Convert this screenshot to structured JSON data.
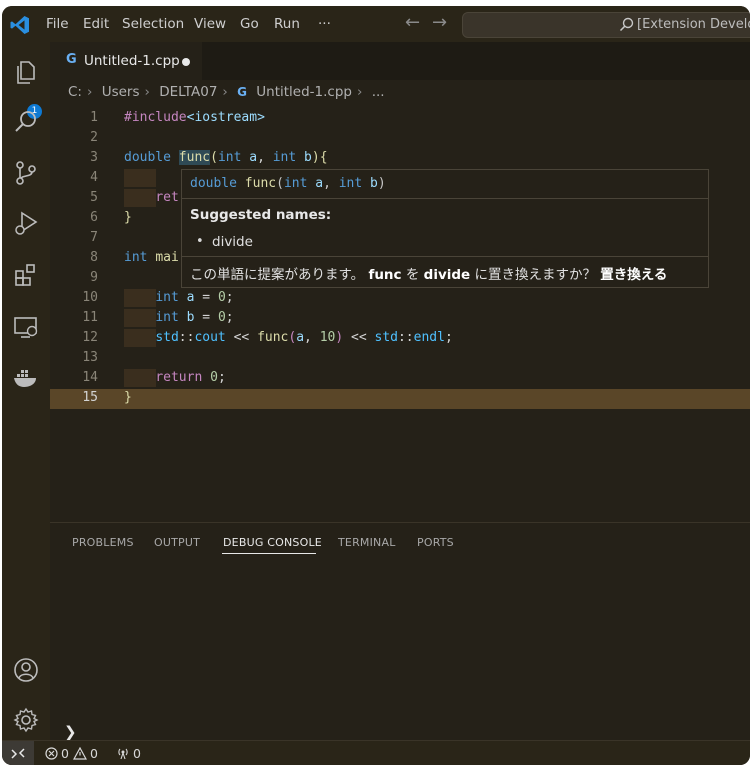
{
  "titlebar": {
    "menus": [
      "File",
      "Edit",
      "Selection",
      "View",
      "Go",
      "Run",
      "···"
    ],
    "search_text": "[Extension Developm"
  },
  "activity": {
    "explorer_badge": "1"
  },
  "tab": {
    "icon": "G",
    "label": "Untitled-1.cpp"
  },
  "breadcrumb": [
    "C:",
    "Users",
    "DELTA07",
    "Untitled-1.cpp",
    "..."
  ],
  "code": {
    "line_numbers": [
      "1",
      "2",
      "3",
      "4",
      "5",
      "6",
      "7",
      "8",
      "9",
      "10",
      "11",
      "12",
      "13",
      "14",
      "15"
    ],
    "l1_inc": "#include",
    "l1_file": "<iostream>",
    "l3_type": "double",
    "l3_fn": "func",
    "l3_p": "(",
    "l3_int1": "int",
    "l3_a": "a",
    "l3_comma": ",",
    "l3_int2": "int",
    "l3_b": "b",
    "l3_end": "){",
    "l5_ret": "ret",
    "l6": "}",
    "l8_int": "int",
    "l8_mai": "mai",
    "l10_int": "int",
    "l10_a": "a",
    "l10_eq": " = ",
    "l10_val": "0",
    "l10_semi": ";",
    "l11_int": "int",
    "l11_b": "b",
    "l11_eq": " = ",
    "l11_val": "0",
    "l11_semi": ";",
    "l12_std1": "std",
    "l12_cc1": "::",
    "l12_cout": "cout",
    "l12_op1": " << ",
    "l12_fn": "func",
    "l12_p1": "(",
    "l12_a": "a",
    "l12_comma": ", ",
    "l12_10": "10",
    "l12_p2": ")",
    "l12_op2": " << ",
    "l12_std2": "std",
    "l12_cc2": "::",
    "l12_endl": "endl",
    "l12_semi": ";",
    "l14_ret": "return",
    "l14_val": "0",
    "l14_semi": ";",
    "l15": "}"
  },
  "hover": {
    "sig_type": "double",
    "sig_fn": "func",
    "sig_p": "(",
    "sig_int1": "int",
    "sig_a": "a",
    "sig_comma": ", ",
    "sig_int2": "int",
    "sig_b": "b",
    "sig_end": ")",
    "heading": "Suggested names:",
    "bullet": "•",
    "item": "divide",
    "action_pre": "この単語に提案があります。",
    "action_old": "func",
    "action_wo": "を",
    "action_new": "divide",
    "action_post": "に置き換えますか？",
    "action_link": "置き換える"
  },
  "panel": {
    "tabs": [
      "PROBLEMS",
      "OUTPUT",
      "DEBUG CONSOLE",
      "TERMINAL",
      "PORTS"
    ],
    "prompt": "❯"
  },
  "statusbar": {
    "errors": "0",
    "warnings": "0",
    "ports": "0"
  },
  "colors": {
    "accent": "#0e7ad3",
    "background": "#252118",
    "current_line": "#5a4628"
  }
}
